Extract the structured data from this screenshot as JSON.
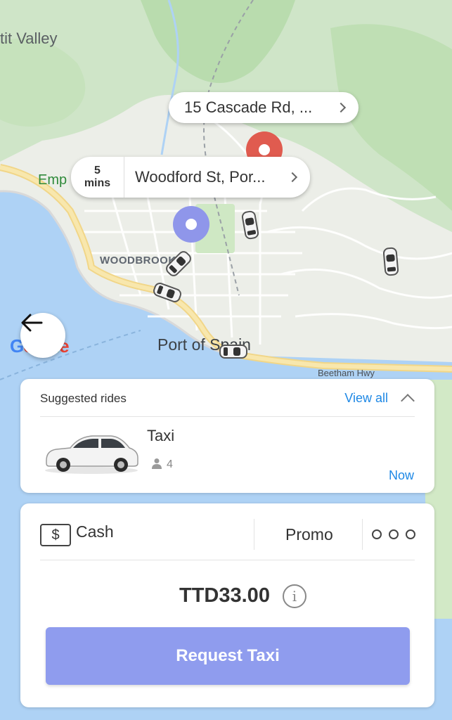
{
  "map": {
    "labels": {
      "valley": "tit Valley",
      "emp": "Emp",
      "woodbrook": "WOODBROOK",
      "port_of_spain": "Port of Spain",
      "beetham": "Beetham Hwy"
    },
    "google_logo": [
      "G",
      "o",
      "o",
      "g",
      "l",
      "e"
    ],
    "destination": {
      "address": "15 Cascade Rd, ...",
      "icon": "chevron-right-icon"
    },
    "origin": {
      "eta_value": "5",
      "eta_unit": "mins",
      "address": "Woodford St, Por...",
      "icon": "chevron-right-icon"
    },
    "pin_colors": {
      "destination": "#e05b4f",
      "origin": "#8f96ea"
    },
    "back_icon": "arrow-left-icon"
  },
  "rides": {
    "heading": "Suggested rides",
    "view_all": "View all",
    "collapse_icon": "chevron-up-icon",
    "items": [
      {
        "name": "Taxi",
        "seats": "4",
        "time": "Now",
        "icon": "car-image"
      }
    ]
  },
  "payment": {
    "method_icon": "cash-icon",
    "method_icon_text": "$",
    "method_label": "Cash",
    "promo_label": "Promo",
    "more_icon": "more-dots-icon",
    "price": "TTD33.00",
    "info_icon_text": "i",
    "request_label": "Request Taxi",
    "accent": "#1e88e5",
    "button_color": "#8f9cee"
  }
}
